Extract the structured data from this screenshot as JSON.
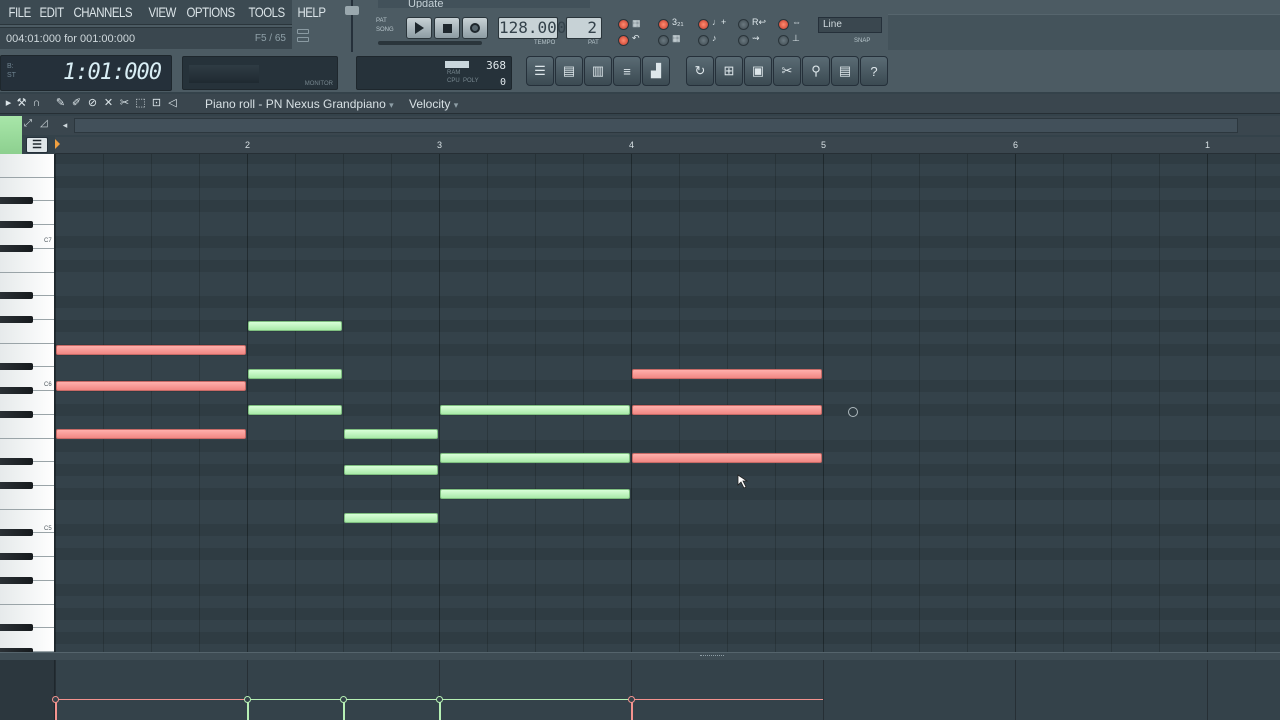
{
  "menu": [
    "FILE",
    "EDIT",
    "CHANNELS",
    "VIEW",
    "OPTIONS",
    "TOOLS",
    "HELP"
  ],
  "hint": {
    "text": "004:01:000 for 001:00:000",
    "right": "F5 / 65"
  },
  "time_display": {
    "value": "1:01:000",
    "small_top": "B:",
    "small_bottom": "ST"
  },
  "monitor_label": "MONITOR",
  "cpu": {
    "value": "368",
    "value2": "0",
    "labels": "RAM\nCPU  POLY"
  },
  "transport": {
    "pat_song": "PAT\nSONG",
    "tempo": "128.000",
    "tempo_label": "TEMPO",
    "pattern": "2",
    "pattern_label": "PAT",
    "update": "Update"
  },
  "snap": {
    "value": "Line",
    "label": "SNAP"
  },
  "window_buttons": [
    "playlist-icon",
    "step-sequencer-icon",
    "piano-roll-icon",
    "browser-icon",
    "mixer-icon"
  ],
  "tool_buttons": [
    "undo-icon",
    "save-icon",
    "export-icon",
    "cut-icon",
    "zoom-icon",
    "sheet-icon",
    "help-icon"
  ],
  "piano_roll": {
    "title": "Piano roll - PN Nexus Grandpiano",
    "target": "Velocity",
    "menu_glyph": "☰"
  },
  "ruler": {
    "bars": [
      "2",
      "3",
      "4",
      "5",
      "6",
      "1"
    ]
  },
  "keyboard": {
    "labels": [
      "C7",
      "C6",
      "C5"
    ]
  },
  "notes": [
    {
      "color": "red",
      "bar_start": 1.0,
      "length_beats": 4,
      "row": 17
    },
    {
      "color": "red",
      "bar_start": 1.0,
      "length_beats": 4,
      "row": 20
    },
    {
      "color": "red",
      "bar_start": 1.0,
      "length_beats": 4,
      "row": 24
    },
    {
      "color": "green",
      "bar_start": 2.0,
      "length_beats": 2,
      "row": 15
    },
    {
      "color": "green",
      "bar_start": 2.0,
      "length_beats": 2,
      "row": 19
    },
    {
      "color": "green",
      "bar_start": 2.0,
      "length_beats": 2,
      "row": 22
    },
    {
      "color": "green",
      "bar_start": 2.5,
      "length_beats": 2,
      "row": 24
    },
    {
      "color": "green",
      "bar_start": 2.5,
      "length_beats": 2,
      "row": 27
    },
    {
      "color": "green",
      "bar_start": 2.5,
      "length_beats": 2,
      "row": 31
    },
    {
      "color": "green",
      "bar_start": 3.0,
      "length_beats": 4,
      "row": 22
    },
    {
      "color": "green",
      "bar_start": 3.0,
      "length_beats": 4,
      "row": 26
    },
    {
      "color": "green",
      "bar_start": 3.0,
      "length_beats": 4,
      "row": 29
    },
    {
      "color": "red",
      "bar_start": 4.0,
      "length_beats": 4,
      "row": 19
    },
    {
      "color": "red",
      "bar_start": 4.0,
      "length_beats": 4,
      "row": 22
    },
    {
      "color": "red",
      "bar_start": 4.0,
      "length_beats": 4,
      "row": 26
    }
  ],
  "velocity_events": [
    {
      "color": "red",
      "bar": 1.0
    },
    {
      "color": "green",
      "bar": 2.0
    },
    {
      "color": "green",
      "bar": 2.5
    },
    {
      "color": "green",
      "bar": 3.0
    },
    {
      "color": "red",
      "bar": 4.0
    }
  ],
  "colors": {
    "note_red": "#f4938f",
    "note_green": "#b6f0b4",
    "grid_bg": "#34424a"
  }
}
